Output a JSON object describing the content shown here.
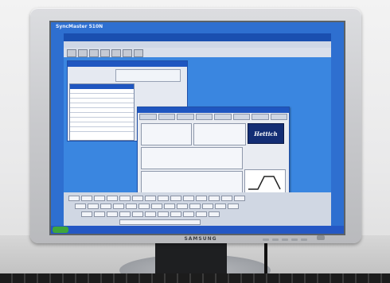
{
  "monitor": {
    "model_label": "SyncMaster 510N",
    "brand": "SAMSUNG"
  },
  "app": {
    "logo_text": "Hettich"
  },
  "colors": {
    "screen_bg": "#2e6fd0",
    "titlebar": "#1a4fb0",
    "panel_header": "#1f56c0",
    "taskbar": "#2457c4",
    "bezel": "#c8c9cc"
  }
}
